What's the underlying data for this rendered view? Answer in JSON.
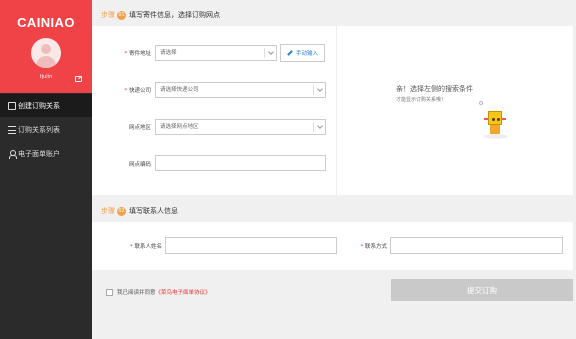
{
  "sidebar": {
    "logo": "CAINIAO",
    "username": "tjulin",
    "nav": [
      {
        "label": "创建订购关系",
        "icon": "edit-icon"
      },
      {
        "label": "订购关系列表",
        "icon": "list-icon"
      },
      {
        "label": "电子面单账户",
        "icon": "user-icon"
      }
    ]
  },
  "step1": {
    "label": "步骤",
    "num": "01",
    "title": "填写寄件信息，选择订购网点",
    "sender_address": {
      "label": "寄件地址",
      "placeholder": "请选择"
    },
    "manual_input": "手动输入",
    "courier": {
      "label": "快递公司",
      "placeholder": "请选择快递公司"
    },
    "outlet_region": {
      "label": "网点地区",
      "placeholder": "请选择网点地区"
    },
    "outlet_code": {
      "label": "网点编码",
      "value": ""
    },
    "hint_title": "亲！选择左侧的搜索条件",
    "hint_sub": "才能显示订购关系哦！"
  },
  "step2": {
    "label": "步骤",
    "num": "02",
    "title": "填写联系人信息",
    "contact_name": {
      "label": "联系人姓名",
      "value": ""
    },
    "contact_method": {
      "label": "联系方式",
      "value": ""
    }
  },
  "footer": {
    "agree_text": "我已阅读并同意",
    "agree_link": "《菜鸟电子面单协议》",
    "submit": "提交订购"
  },
  "colors": {
    "brand": "#f04347",
    "step_accent": "#f0a048",
    "sidebar_bg": "#2b2b2b"
  }
}
